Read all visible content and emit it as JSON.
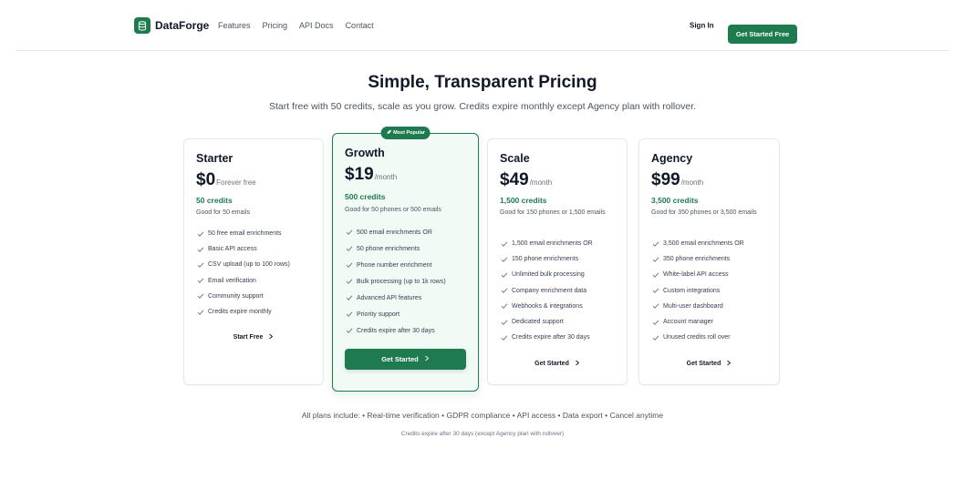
{
  "nav": {
    "brand": "DataForge",
    "links": [
      "Features",
      "Pricing",
      "API Docs",
      "Contact"
    ],
    "sign_in": "Sign In",
    "cta": "Get Started Free",
    "brand_icon": "database-icon"
  },
  "hero": {
    "title": "Simple, Transparent Pricing",
    "subtitle": "Start free with 50 credits, scale as you grow. Credits expire monthly except Agency plan with rollover."
  },
  "plans": [
    {
      "name": "Starter",
      "price": "$0",
      "period": "Forever free",
      "credits": "50 credits",
      "credits_desc": "Good for 50 emails",
      "features": [
        "50 free email enrichments",
        "Basic API access",
        "CSV upload (up to 100 rows)",
        "Email verification",
        "Community support",
        "Credits expire monthly"
      ],
      "button": "Start Free"
    },
    {
      "name": "Growth",
      "badge": "Most Popular",
      "price": "$19",
      "period": "/month",
      "credits": "500 credits",
      "credits_desc": "Good for 50 phones or 500 emails",
      "features": [
        "500 email enrichments OR",
        "50 phone enrichments",
        "Phone number enrichment",
        "Bulk processing (up to 1k rows)",
        "Advanced API features",
        "Priority support",
        "Credits expire after 30 days"
      ],
      "button": "Get Started"
    },
    {
      "name": "Scale",
      "price": "$49",
      "period": "/month",
      "credits": "1,500 credits",
      "credits_desc": "Good for 150 phones or 1,500 emails",
      "features": [
        "1,500 email enrichments OR",
        "150 phone enrichments",
        "Unlimited bulk processing",
        "Company enrichment data",
        "Webhooks & integrations",
        "Dedicated support",
        "Credits expire after 30 days"
      ],
      "button": "Get Started"
    },
    {
      "name": "Agency",
      "price": "$99",
      "period": "/month",
      "credits": "3,500 credits",
      "credits_desc": "Good for 350 phones or 3,500 emails",
      "features": [
        "3,500 email enrichments OR",
        "350 phone enrichments",
        "White-label API access",
        "Custom integrations",
        "Multi-user dashboard",
        "Account manager",
        "Unused credits roll over"
      ],
      "button": "Get Started"
    }
  ],
  "footer": {
    "includes": "All plans include: • Real-time verification • GDPR compliance • API access • Data export • Cancel anytime",
    "note": "Credits expire after 30 days (except Agency plan with rollover)"
  },
  "colors": {
    "accent": "#1e7a4f",
    "popular_bg": "#f2faf5",
    "text": "#111827",
    "muted": "#4b5563"
  }
}
